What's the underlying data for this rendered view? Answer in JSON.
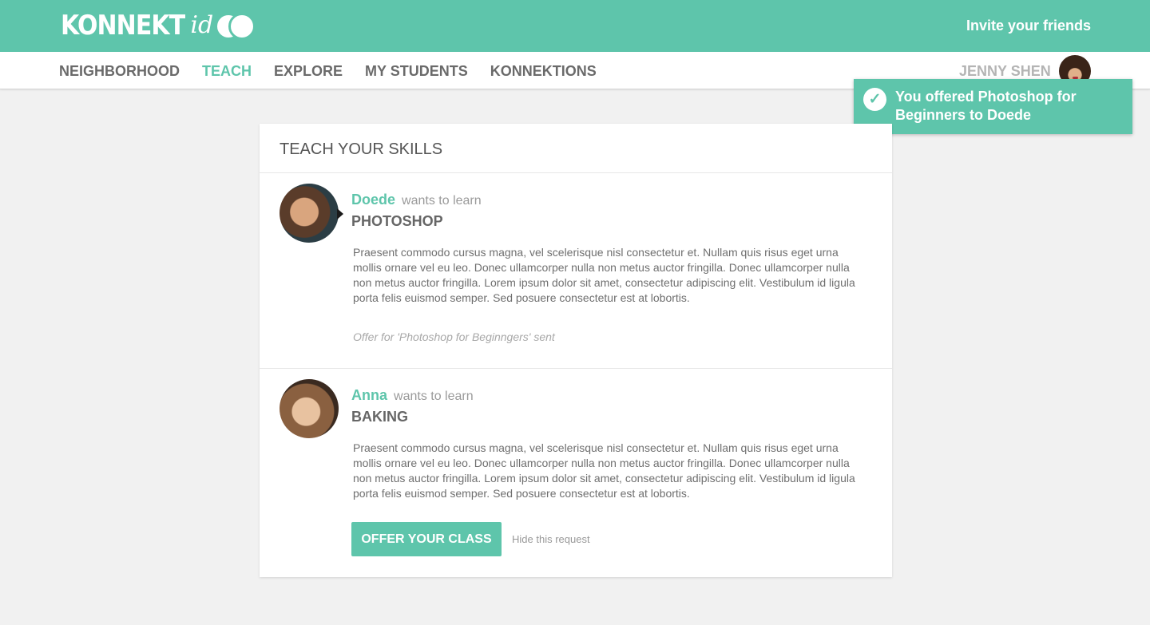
{
  "brand": {
    "logo_main": "KONNEKT",
    "logo_accent": "id"
  },
  "header": {
    "invite_link": "Invite your friends"
  },
  "nav": {
    "items": [
      {
        "label": "NEIGHBORHOOD",
        "active": false
      },
      {
        "label": "TEACH",
        "active": true
      },
      {
        "label": "EXPLORE",
        "active": false
      },
      {
        "label": "MY STUDENTS",
        "active": false
      },
      {
        "label": "KONNEKTIONS",
        "active": false
      }
    ],
    "user_name": "JENNY SHEN"
  },
  "toast": {
    "message": "You offered Photoshop for Beginners to Doede",
    "icon": "check-icon"
  },
  "card": {
    "title": "TEACH YOUR SKILLS",
    "requests": [
      {
        "name": "Doede",
        "wants_label": "wants to learn",
        "skill": "PHOTOSHOP",
        "description": "Praesent commodo cursus magna, vel scelerisque nisl consectetur et. Nullam quis risus eget urna mollis ornare vel eu leo. Donec ullamcorper nulla non metus auctor fringilla. Donec ullamcorper nulla non metus auctor fringilla. Lorem ipsum dolor sit amet, consectetur adipiscing elit. Vestibulum id ligula porta felis euismod semper. Sed posuere consectetur est at lobortis.",
        "status": "Offer for 'Photoshop for Beginngers' sent"
      },
      {
        "name": "Anna",
        "wants_label": "wants to learn",
        "skill": "BAKING",
        "description": "Praesent commodo cursus magna, vel scelerisque nisl consectetur et. Nullam quis risus eget urna mollis ornare vel eu leo. Donec ullamcorper nulla non metus auctor fringilla. Donec ullamcorper nulla non metus auctor fringilla. Lorem ipsum dolor sit amet, consectetur adipiscing elit. Vestibulum id ligula porta felis euismod semper. Sed posuere consectetur est at lobortis.",
        "offer_button": "OFFER YOUR CLASS",
        "hide_link": "Hide this request"
      }
    ]
  },
  "colors": {
    "accent": "#5ec5ab",
    "background": "#f1f1f1",
    "text_muted": "#9a9a9a"
  }
}
